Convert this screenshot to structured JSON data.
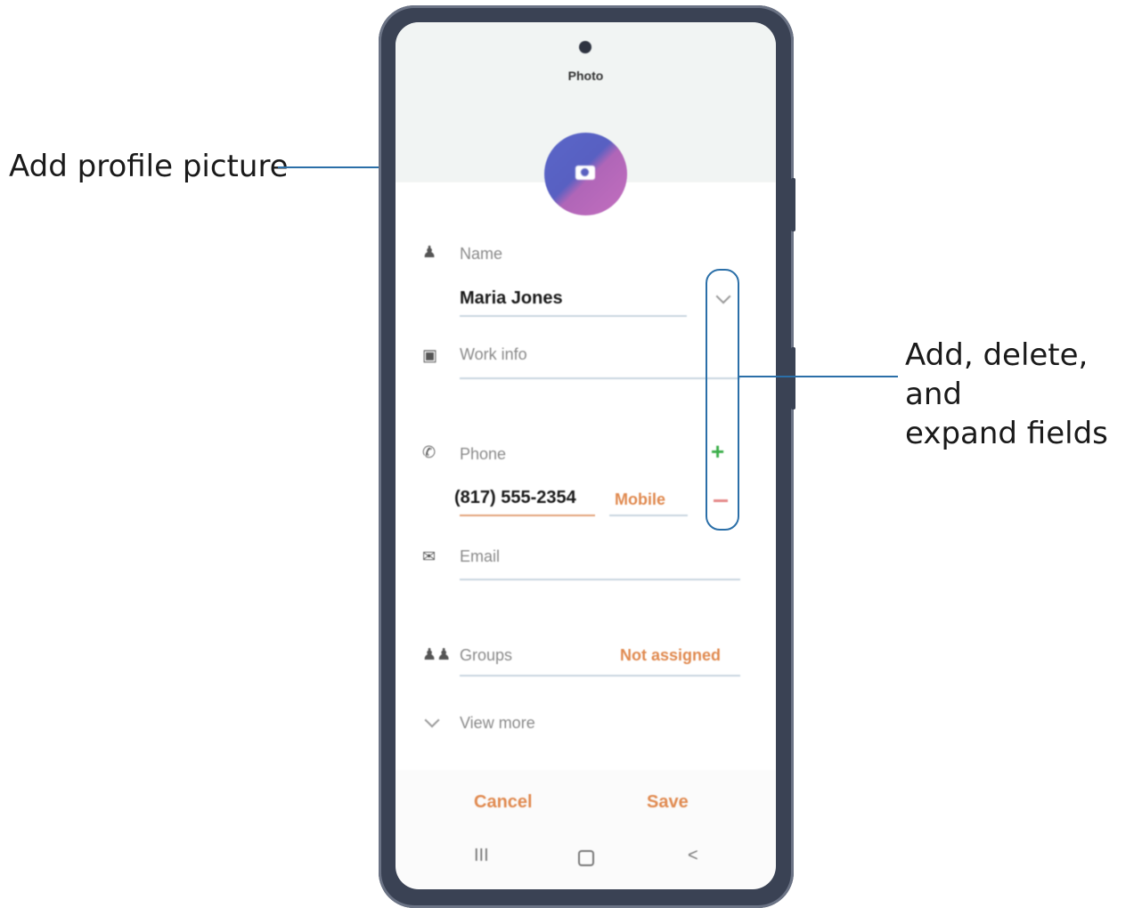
{
  "callouts": {
    "profile_picture": "Add profile picture",
    "fields_line1": "Add, delete, and",
    "fields_line2": "expand fields"
  },
  "screen": {
    "photo_label": "Photo",
    "name_label": "Name",
    "name_value": "Maria Jones",
    "work_label": "Work info",
    "phone_label": "Phone",
    "phone_value": "(817) 555-2354",
    "phone_type": "Mobile",
    "email_label": "Email",
    "groups_label": "Groups",
    "groups_value": "Not assigned",
    "view_more": "View more",
    "cancel": "Cancel",
    "save": "Save",
    "nav_recent": "III",
    "nav_back": "<"
  },
  "colors": {
    "callout_line": "#2b6fa8",
    "accent_orange": "#e08a50",
    "add_green": "#3cae4a",
    "remove_red": "#e58a8a",
    "avatar_blue": "#5a66c8",
    "avatar_pink": "#c36fbf"
  },
  "icons": [
    "person-icon",
    "work-icon",
    "phone-icon",
    "email-icon",
    "groups-icon",
    "chevron-down-icon",
    "camera-icon",
    "plus-icon",
    "minus-icon"
  ]
}
